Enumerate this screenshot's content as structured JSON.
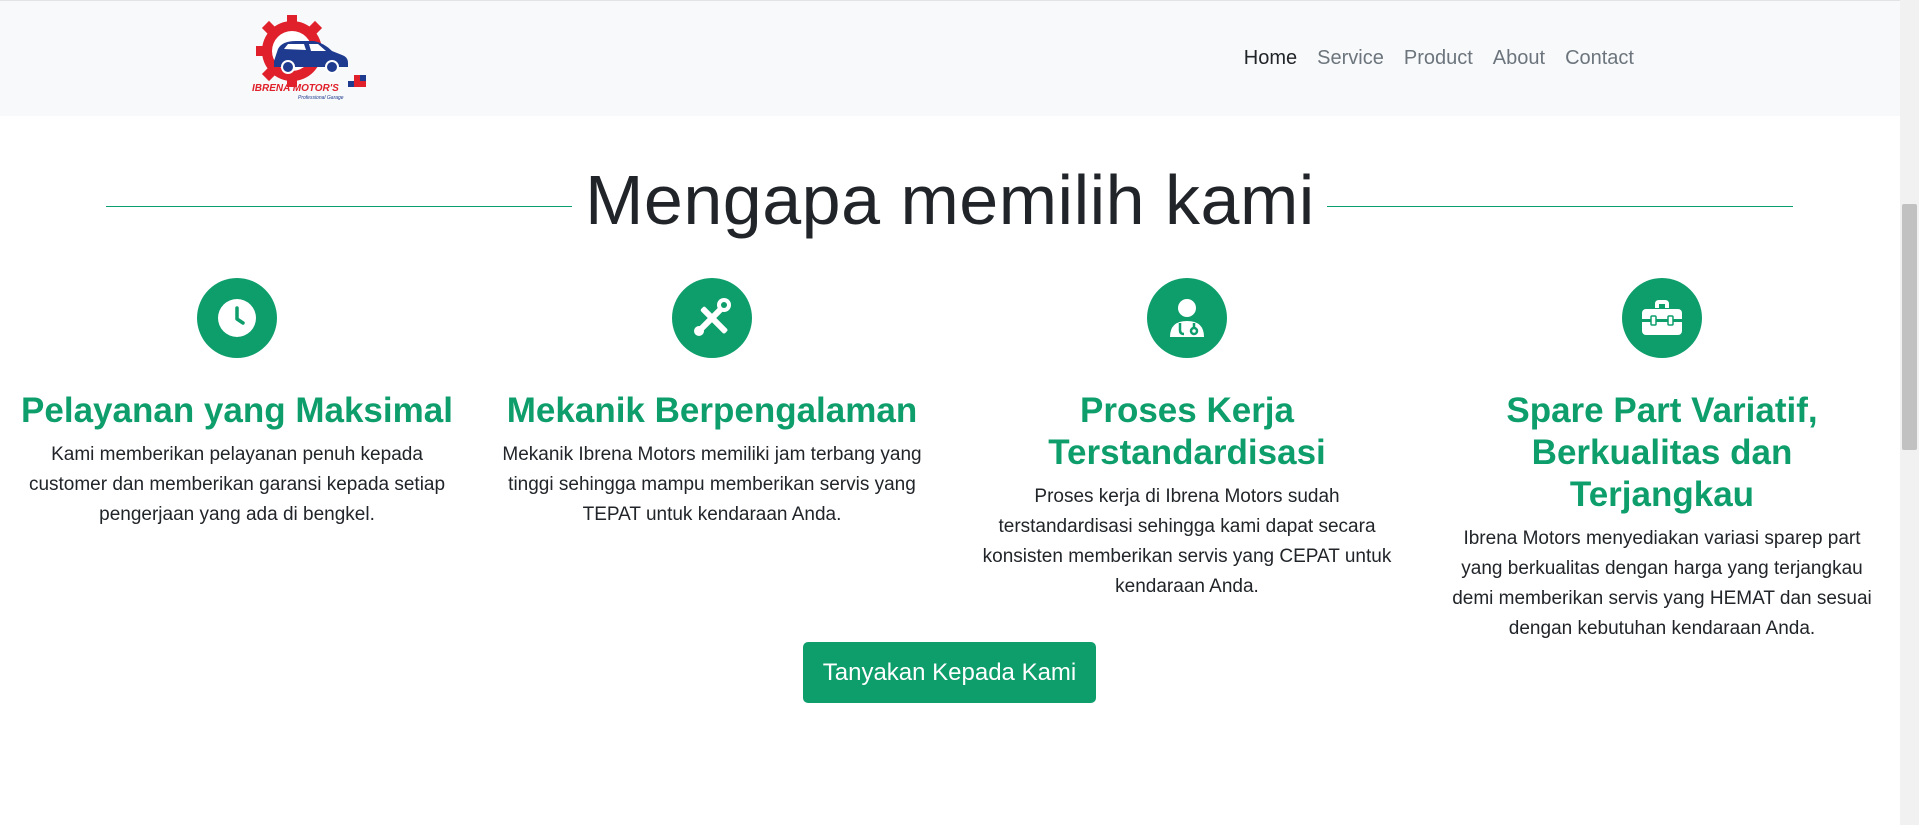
{
  "brand": {
    "logo_text": "IBRENA MOTOR'S",
    "logo_subtext": "Professional Garage"
  },
  "nav": {
    "items": [
      {
        "label": "Home",
        "active": true
      },
      {
        "label": "Service",
        "active": false
      },
      {
        "label": "Product",
        "active": false
      },
      {
        "label": "About",
        "active": false
      },
      {
        "label": "Contact",
        "active": false
      }
    ]
  },
  "section": {
    "title": "Mengapa memilih kami"
  },
  "features": [
    {
      "icon": "clock-icon",
      "title": "Pelayanan yang Maksimal",
      "text": "Kami memberikan pelayanan penuh kepada customer dan memberikan garansi kepada setiap pengerjaan yang ada di bengkel."
    },
    {
      "icon": "tools-icon",
      "title": "Mekanik Berpengalaman",
      "text": "Mekanik Ibrena Motors memiliki jam terbang yang tinggi sehingga mampu memberikan servis yang TEPAT untuk kendaraan Anda."
    },
    {
      "icon": "doctor-icon",
      "title": "Proses Kerja Terstandardisasi",
      "text": "Proses kerja di Ibrena Motors sudah terstandardisasi sehingga kami dapat secara konsisten memberikan servis yang CEPAT untuk kendaraan Anda."
    },
    {
      "icon": "toolbox-icon",
      "title": "Spare Part Variatif, Berkualitas dan Terjangkau",
      "text": "Ibrena Motors menyediakan variasi sparep part yang berkualitas dengan harga yang terjangkau demi memberikan servis yang HEMAT dan sesuai dengan kebutuhan kendaraan Anda."
    }
  ],
  "cta": {
    "label": "Tanyakan Kepada Kami"
  },
  "colors": {
    "accent": "#0d9e6c",
    "nav_bg": "#f8f9fa",
    "logo_red": "#e0202a",
    "logo_blue": "#1f3b8f"
  }
}
